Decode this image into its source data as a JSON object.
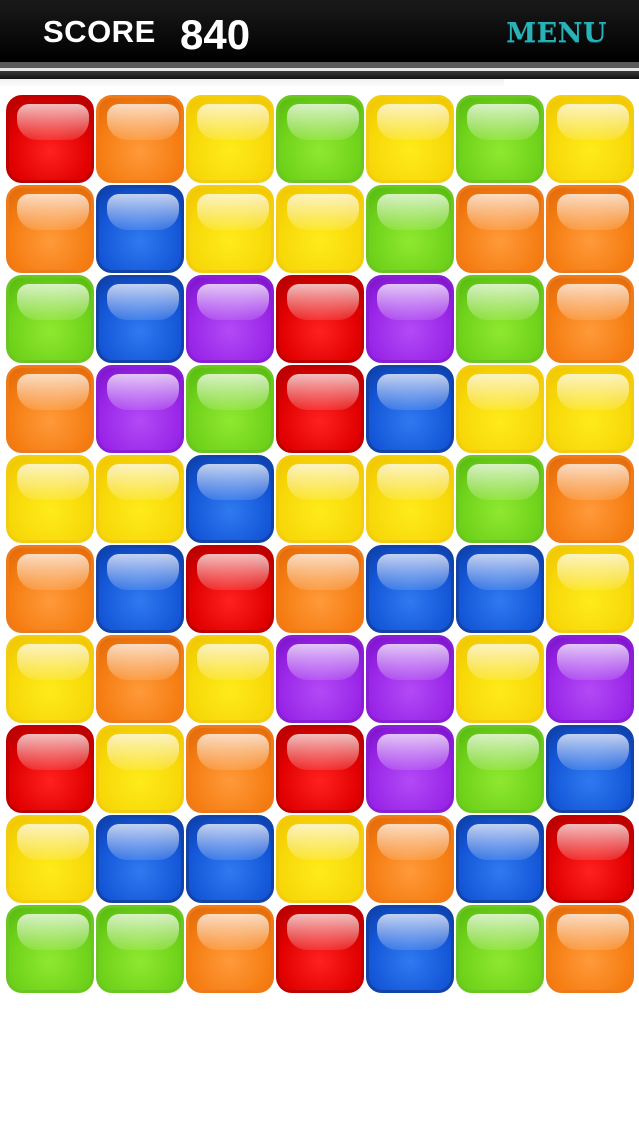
{
  "header": {
    "score_label": "SCORE",
    "score_value": "840",
    "menu_label": "MENU"
  },
  "board": {
    "columns": 7,
    "rows": 10,
    "grid": [
      [
        "red",
        "orange",
        "yellow",
        "green",
        "yellow",
        "green",
        "yellow"
      ],
      [
        "orange",
        "blue",
        "yellow",
        "yellow",
        "green",
        "orange",
        "orange"
      ],
      [
        "green",
        "blue",
        "purple",
        "red",
        "purple",
        "green",
        "orange"
      ],
      [
        "orange",
        "purple",
        "green",
        "red",
        "blue",
        "yellow",
        "yellow"
      ],
      [
        "yellow",
        "yellow",
        "blue",
        "yellow",
        "yellow",
        "green",
        "orange"
      ],
      [
        "orange",
        "blue",
        "red",
        "orange",
        "blue",
        "blue",
        "yellow"
      ],
      [
        "yellow",
        "orange",
        "yellow",
        "purple",
        "purple",
        "yellow",
        "purple"
      ],
      [
        "red",
        "yellow",
        "orange",
        "red",
        "purple",
        "green",
        "blue"
      ],
      [
        "yellow",
        "blue",
        "blue",
        "yellow",
        "orange",
        "blue",
        "red"
      ],
      [
        "green",
        "green",
        "orange",
        "red",
        "blue",
        "green",
        "orange"
      ]
    ]
  },
  "colors": {
    "topbar": "#000000",
    "menu_accent": "#29b3b8",
    "red": "#e00000",
    "orange": "#f57d12",
    "yellow": "#f7d808",
    "green": "#6fd21a",
    "blue": "#1457d8",
    "purple": "#9a26e8"
  }
}
